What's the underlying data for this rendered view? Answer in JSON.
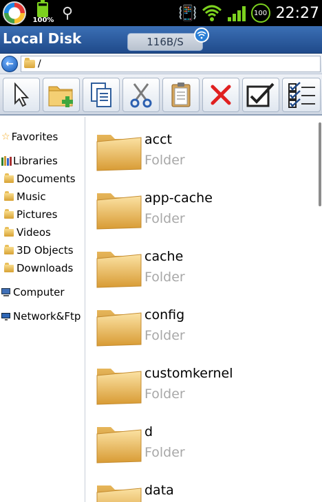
{
  "status_bar": {
    "battery_label": "100%",
    "cpu_badge": "100",
    "clock": "22:27",
    "icons": [
      "app-launcher-icon",
      "battery-icon",
      "usb-icon",
      "vibrate-icon",
      "wifi-icon",
      "signal-icon",
      "cpu-icon"
    ]
  },
  "titlebar": {
    "title": "Local Disk",
    "speed": "116B/S"
  },
  "pathbar": {
    "path": "/"
  },
  "toolbar": {
    "buttons": [
      "select",
      "new-folder",
      "copy",
      "cut",
      "paste",
      "delete",
      "check",
      "multi-select"
    ]
  },
  "sidebar": {
    "favorites": "Favorites",
    "libraries": "Libraries",
    "library_items": [
      "Documents",
      "Music",
      "Pictures",
      "Videos",
      "3D Objects",
      "Downloads"
    ],
    "computer": "Computer",
    "network": "Network&Ftp"
  },
  "files": [
    {
      "name": "acct",
      "type": "Folder"
    },
    {
      "name": "app-cache",
      "type": "Folder"
    },
    {
      "name": "cache",
      "type": "Folder"
    },
    {
      "name": "config",
      "type": "Folder"
    },
    {
      "name": "customkernel",
      "type": "Folder"
    },
    {
      "name": "d",
      "type": "Folder"
    },
    {
      "name": "data",
      "type": ""
    }
  ],
  "colors": {
    "title_bar": "#2b5a9e",
    "accent_green": "#7cd11f",
    "folder": "#e8bb55"
  }
}
